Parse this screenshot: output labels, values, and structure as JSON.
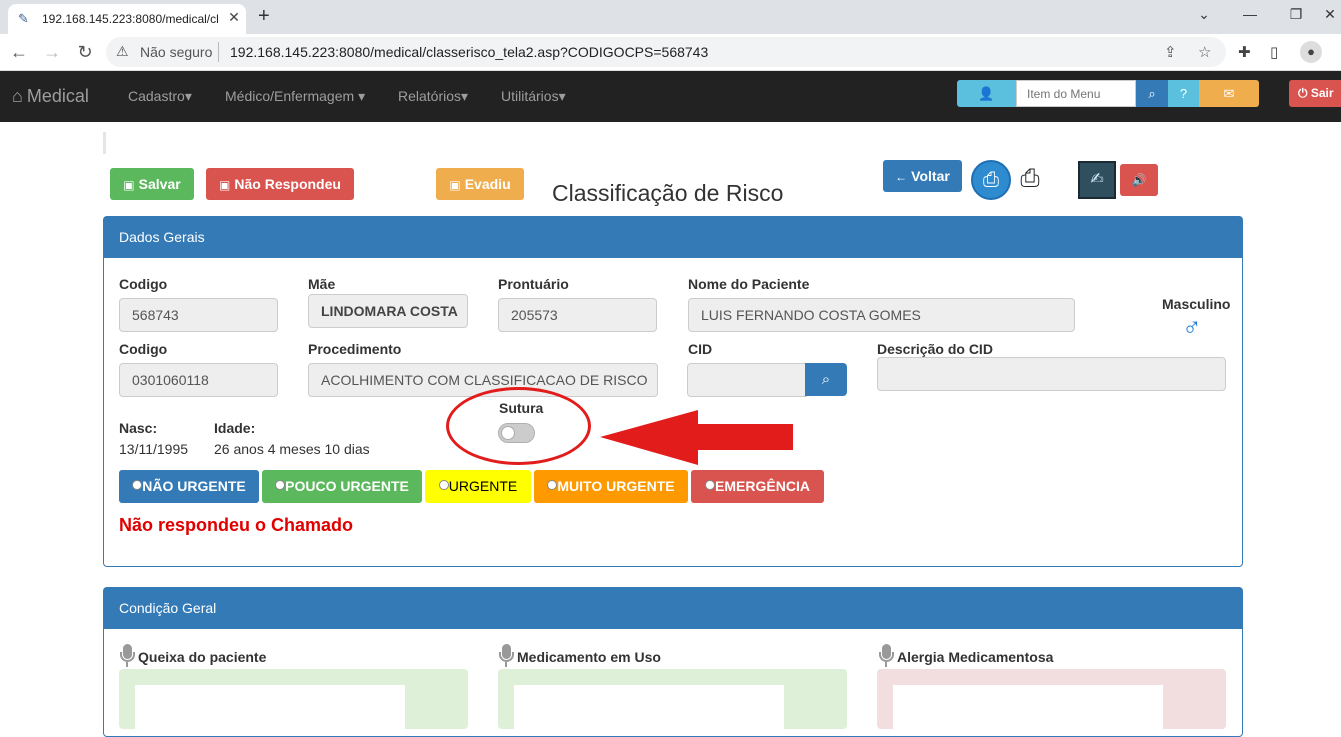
{
  "browser": {
    "tab_title": "192.168.145.223:8080/medical/cl",
    "tab_close": "✕",
    "new_tab": "+",
    "insecure_label": "Não seguro",
    "url": "192.168.145.223:8080/medical/classerisco_tela2.asp?CODIGOCPS=568743"
  },
  "navbar": {
    "brand": "Medical",
    "menus": [
      "Cadastro",
      "Médico/Enfermagem",
      "Relatórios",
      "Utilitários"
    ],
    "menu_search_placeholder": "Item do Menu",
    "exit_label": "Sair"
  },
  "toolbar": {
    "save_label": "Salvar",
    "no_answer_label": "Não Respondeu",
    "evaded_label": "Evadiu",
    "back_label": "Voltar"
  },
  "page_title": "Classificação de Risco",
  "dados_gerais": {
    "heading": "Dados Gerais",
    "codigo_label": "Codigo",
    "codigo_value": "568743",
    "mae_label": "Mãe",
    "mae_value": "LINDOMARA COSTA",
    "prontuario_label": "Prontuário",
    "prontuario_value": "205573",
    "nome_label": "Nome do Paciente",
    "nome_value": "LUIS FERNANDO COSTA GOMES",
    "sexo_label": "Masculino",
    "codigo2_label": "Codigo",
    "codigo2_value": "0301060118",
    "procedimento_label": "Procedimento",
    "procedimento_value": "ACOLHIMENTO COM CLASSIFICACAO DE RISCO",
    "cid_label": "CID",
    "cid_value": "",
    "desc_cid_label": "Descrição do CID",
    "desc_cid_value": "",
    "nasc_label": "Nasc:",
    "nasc_value": "13/11/1995",
    "idade_label": "Idade:",
    "idade_value": "26 anos 4 meses 10 dias",
    "sutura_label": "Sutura",
    "sutura_on": false
  },
  "risk_levels": [
    {
      "label": "NÃO URGENTE",
      "color": "#337ab7"
    },
    {
      "label": "POUCO URGENTE",
      "color": "#5cb85c"
    },
    {
      "label": "URGENTE",
      "color": "#ffff00"
    },
    {
      "label": "MUITO URGENTE",
      "color": "#ff9900"
    },
    {
      "label": "EMERGÊNCIA",
      "color": "#d9534f"
    }
  ],
  "status_message": "Não respondeu o Chamado",
  "condicao_geral": {
    "heading": "Condição Geral",
    "queixa_label": "Queixa do paciente",
    "medicamento_label": "Medicamento em Uso",
    "alergia_label": "Alergia Medicamentosa"
  },
  "colors": {
    "primary": "#337ab7",
    "success": "#5cb85c",
    "danger": "#d9534f",
    "warning": "#f0ad4e",
    "annotation_red": "#e21b1b"
  }
}
